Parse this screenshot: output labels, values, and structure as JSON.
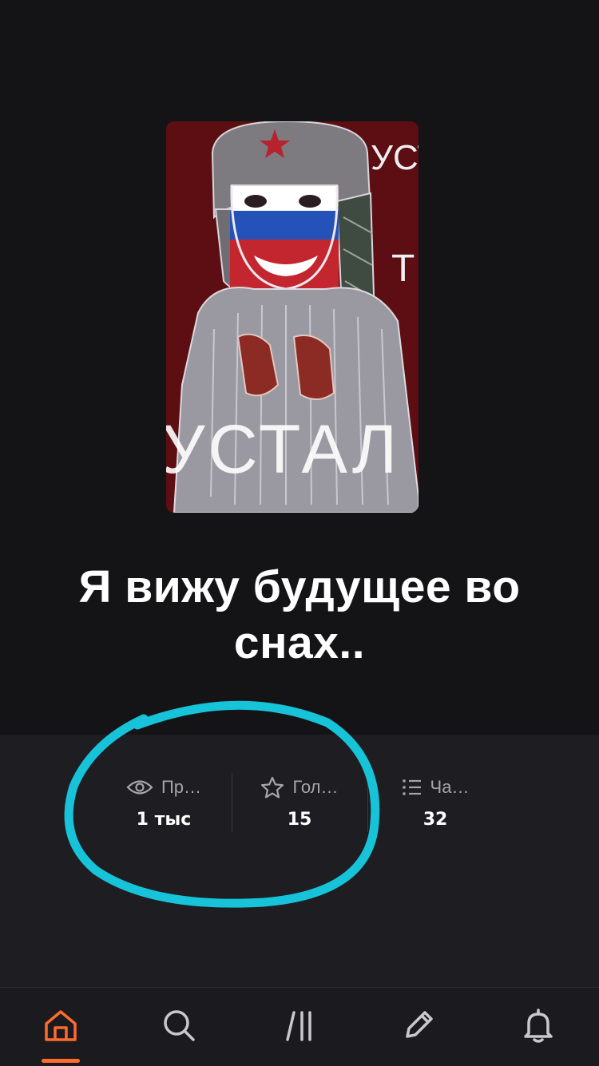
{
  "story": {
    "title": "Я вижу будущее во снах..",
    "cover_caption_top": "УСТ",
    "cover_caption_mid": "Т",
    "cover_caption_bottom": "УСТАЛ"
  },
  "stats": [
    {
      "icon": "eye-icon",
      "label": "Пр…",
      "value": "1 тыс"
    },
    {
      "icon": "star-icon",
      "label": "Гол…",
      "value": "15"
    },
    {
      "icon": "list-icon",
      "label": "Ча…",
      "value": "32"
    }
  ],
  "tabs": [
    {
      "icon": "home-icon",
      "active": true
    },
    {
      "icon": "search-icon",
      "active": false
    },
    {
      "icon": "library-icon",
      "active": false
    },
    {
      "icon": "write-icon",
      "active": false
    },
    {
      "icon": "notifications-icon",
      "active": false
    }
  ],
  "colors": {
    "accent": "#ff6b2c",
    "annotation": "#17c3d8",
    "background": "#141316",
    "panel": "#1e1d21"
  }
}
